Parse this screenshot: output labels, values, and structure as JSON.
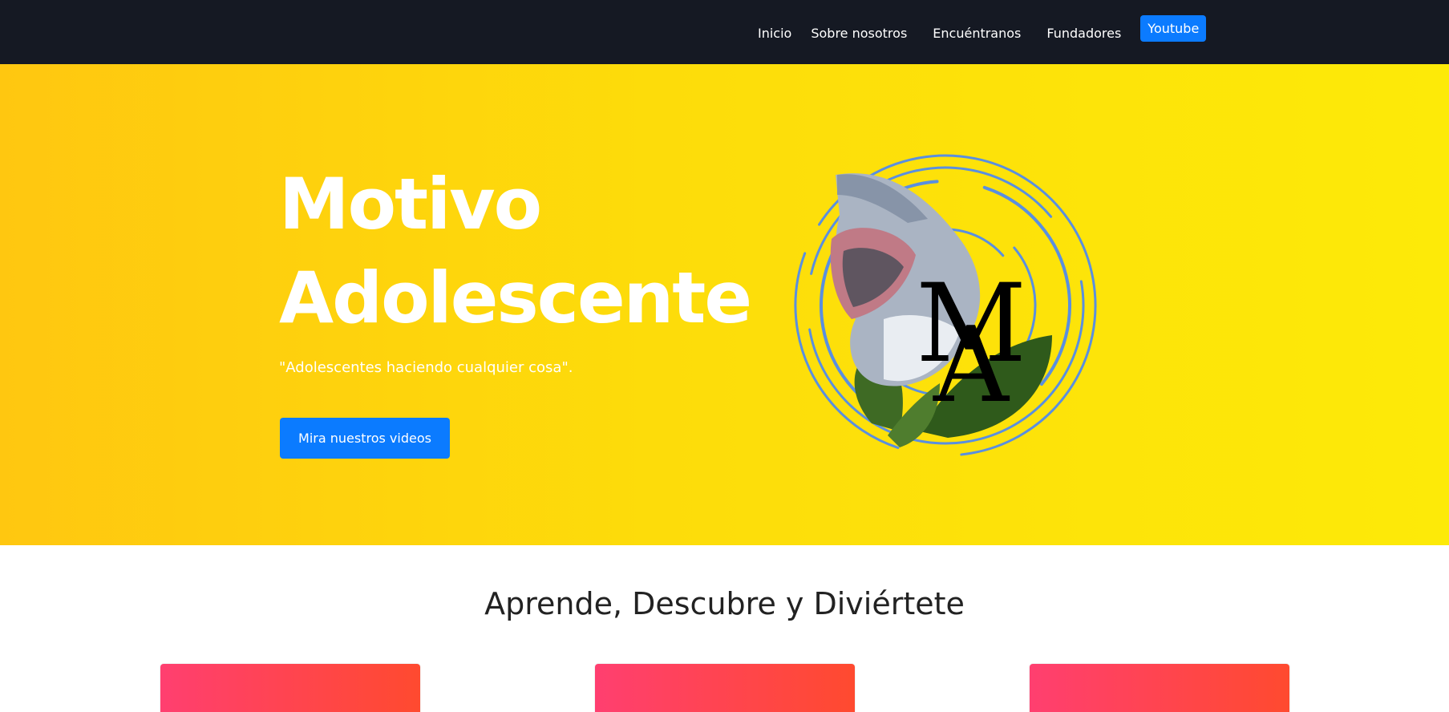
{
  "nav": {
    "items": [
      {
        "label": "Inicio"
      },
      {
        "label": "Sobre nosotros"
      },
      {
        "label": "Encuéntranos"
      },
      {
        "label": "Fundadores"
      }
    ],
    "youtube_label": "Youtube"
  },
  "hero": {
    "title_line1": "Motivo",
    "title_line2": "Adolescente",
    "subtitle": "\"Adolescentes haciendo cualquier cosa\".",
    "cta_label": "Mira nuestros videos",
    "logo_icon": "motivo-adolescente-logo-icon",
    "logo_lettering": "MA"
  },
  "section": {
    "title": "Aprende, Descubre y Diviértete",
    "cards_count": 3
  },
  "colors": {
    "navbar_bg": "#151923",
    "hero_gradient_start": "#ffc710",
    "hero_gradient_end": "#fdea08",
    "primary_button": "#0b7bff",
    "card_gradient_start": "#ff3f70",
    "card_gradient_end": "#ff4a2f",
    "logo_ring": "#5a8fe0"
  }
}
